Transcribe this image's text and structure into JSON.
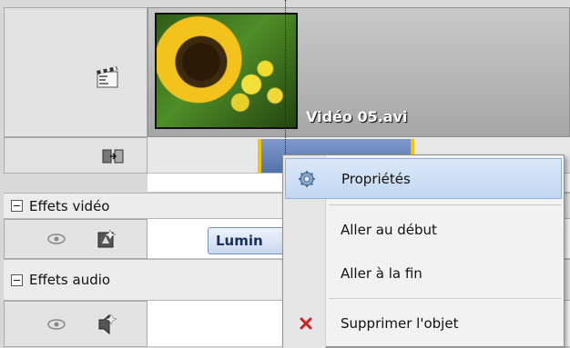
{
  "timeline": {
    "clip_name": "Vidéo 05.avi",
    "effect_clip_label": "Lumin"
  },
  "sections": {
    "video_effects": "Effets vidéo",
    "audio_effects": "Effets audio"
  },
  "context_menu": {
    "items": [
      {
        "label": "Propriétés",
        "icon": "gear-icon",
        "highlighted": true
      },
      {
        "label": "Aller au début"
      },
      {
        "label": "Aller à la fin"
      },
      {
        "label": "Supprimer l'objet",
        "icon": "red-x-icon"
      }
    ]
  },
  "colors": {
    "highlight": "#c2d7f1",
    "clip_border": "#f3c500",
    "delete_icon": "#d02020"
  }
}
